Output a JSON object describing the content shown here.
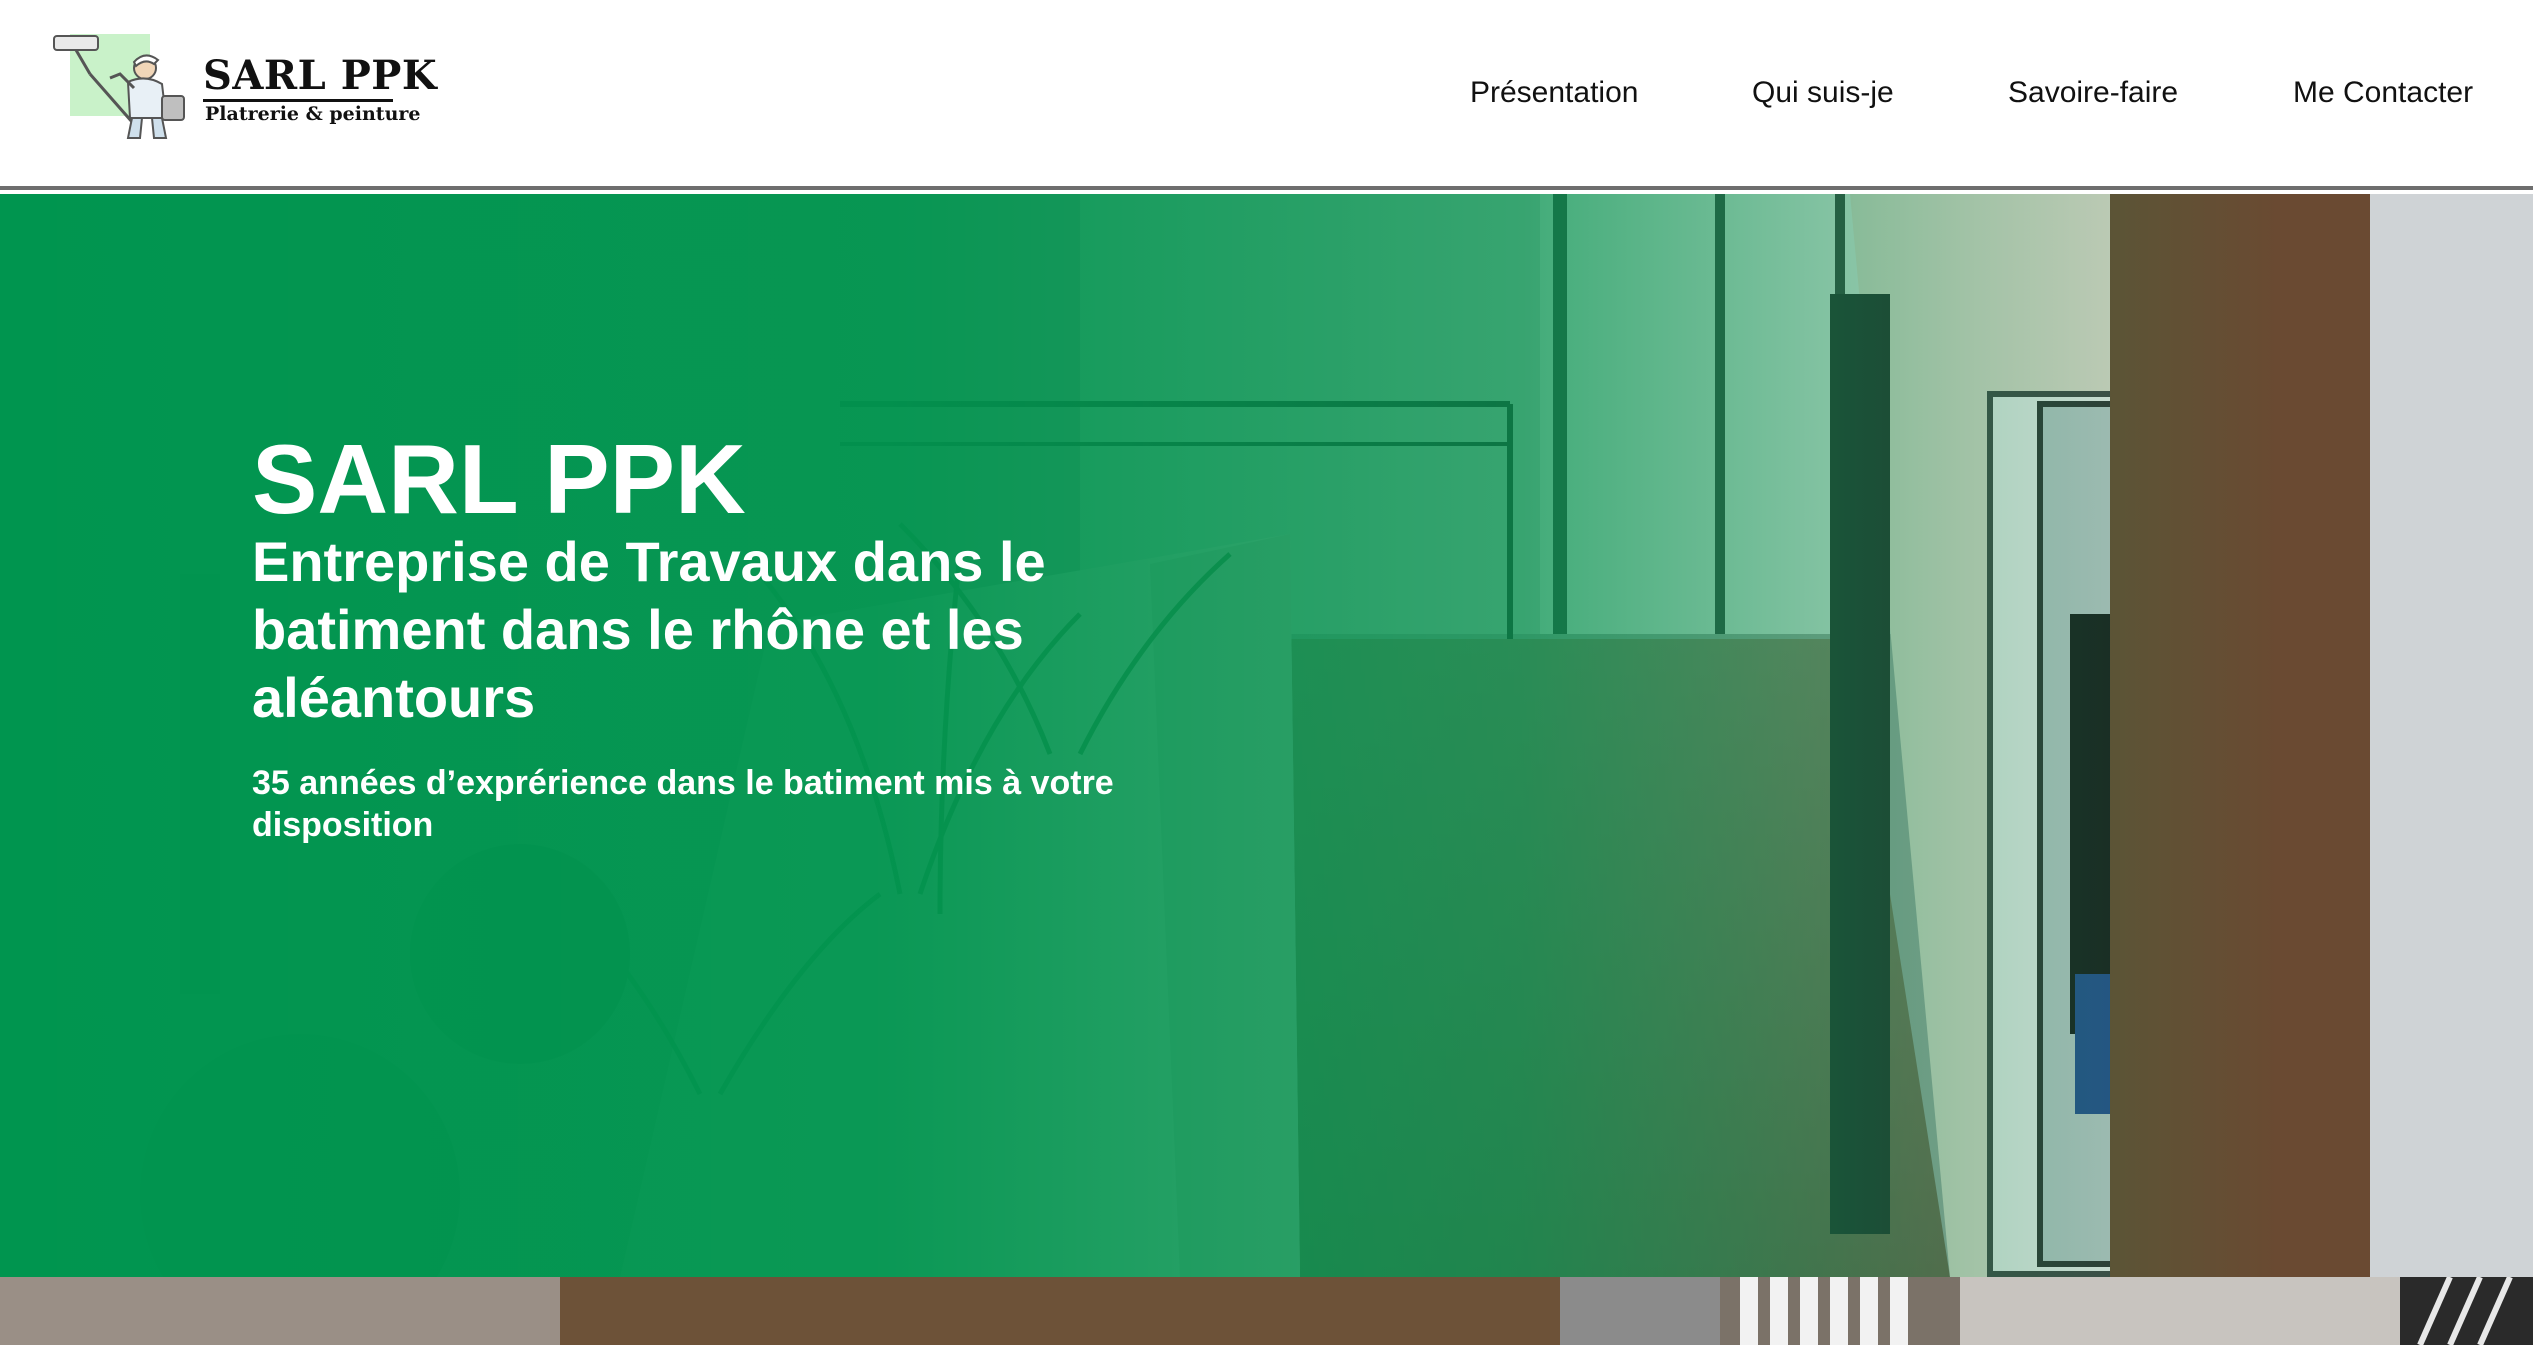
{
  "header": {
    "logo": {
      "title": "SARL PPK",
      "subtitle": "Platrerie & peinture",
      "icon": "painter-mascot-icon"
    },
    "nav": [
      {
        "label": "Présentation"
      },
      {
        "label": "Qui suis-je"
      },
      {
        "label": "Savoire-faire"
      },
      {
        "label": "Me Contacter"
      }
    ]
  },
  "hero": {
    "title": "SARL PPK",
    "subtitle": "Entreprise de Travaux dans le batiment dans le rhône et les aléantours",
    "tagline": "35 années d’exprérience dans le batiment mis à votre disposition",
    "background": "office-interior-photo",
    "overlay_color": "#00954f"
  },
  "colors": {
    "brand_green": "#00954f",
    "text_dark": "#111111",
    "text_light": "#ffffff",
    "header_border": "#6e6e6e"
  }
}
